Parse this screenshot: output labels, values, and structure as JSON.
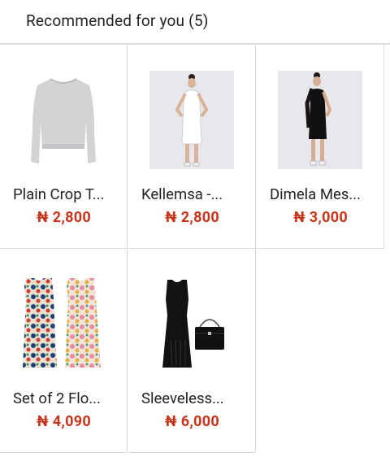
{
  "header": {
    "title": "Recommended for you (5)"
  },
  "products": [
    {
      "name": "Plain Crop T...",
      "price": "₦ 2,800",
      "image": "grey-sweatshirt"
    },
    {
      "name": "Kellemsa -...",
      "price": "₦ 2,800",
      "image": "white-dress-model"
    },
    {
      "name": "Dimela Mes...",
      "price": "₦ 3,000",
      "image": "black-dress-model"
    },
    {
      "name": "Set of 2 Flo...",
      "price": "₦ 4,090",
      "image": "floral-dresses"
    },
    {
      "name": "Sleeveless...",
      "price": "₦ 6,000",
      "image": "black-dress-with-bag"
    }
  ],
  "colors": {
    "price": "#c8331a",
    "divider": "#dadada"
  }
}
